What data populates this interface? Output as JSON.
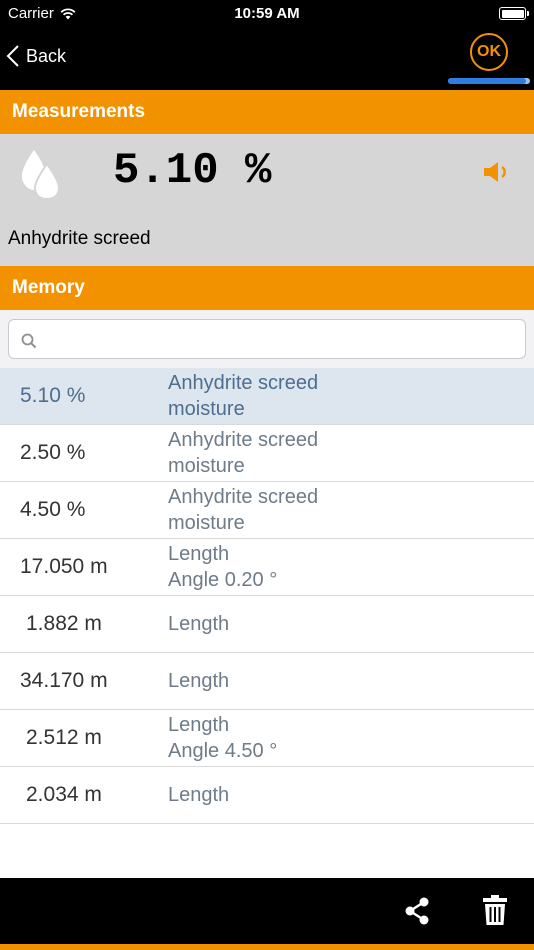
{
  "status_bar": {
    "carrier": "Carrier",
    "time": "10:59 AM"
  },
  "nav": {
    "back_label": "Back",
    "ok_label": "OK",
    "progress_fraction": 0.95
  },
  "measurements": {
    "header": "Measurements",
    "value": "5.10 %",
    "material": "Anhydrite screed"
  },
  "memory": {
    "header": "Memory",
    "search_placeholder": "",
    "items": [
      {
        "value": "5.10 %",
        "line1": "Anhydrite screed",
        "line2": "moisture",
        "selected": true
      },
      {
        "value": "2.50 %",
        "line1": "Anhydrite screed",
        "line2": "moisture",
        "selected": false
      },
      {
        "value": "4.50 %",
        "line1": "Anhydrite screed",
        "line2": "moisture",
        "selected": false
      },
      {
        "value": "17.050 m",
        "line1": "Length",
        "line2": "Angle  0.20 °",
        "selected": false
      },
      {
        "value": "1.882 m",
        "line1": "Length",
        "line2": "",
        "selected": false
      },
      {
        "value": "34.170 m",
        "line1": "Length",
        "line2": "",
        "selected": false
      },
      {
        "value": "2.512 m",
        "line1": "Length",
        "line2": "Angle  4.50 °",
        "selected": false
      },
      {
        "value": "2.034 m",
        "line1": "Length",
        "line2": "",
        "selected": false
      }
    ]
  },
  "colors": {
    "accent": "#f39200",
    "selected_row": "#dde6ef",
    "panel": "#d6d6d6"
  },
  "toolbar": {
    "icons": [
      "share-icon",
      "trash-icon"
    ]
  }
}
